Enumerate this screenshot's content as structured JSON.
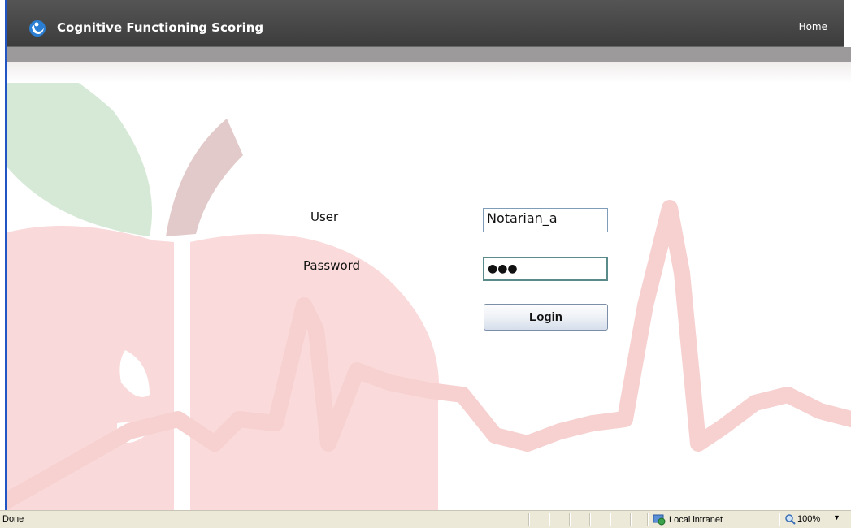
{
  "header": {
    "app_title": "Cognitive Functioning Scoring",
    "home_label": "Home"
  },
  "login": {
    "user_label": "User",
    "password_label": "Password",
    "user_value": "Notarian_a",
    "password_mask": "●●●",
    "login_button": "Login"
  },
  "status_bar": {
    "status": "Done",
    "zone": "Local intranet",
    "zoom": "100%"
  },
  "colors": {
    "header_bg": "#3c3c3c",
    "subbar_bg": "#9c9a9a",
    "apple_red": "#f9d6d6",
    "leaf_green": "#d6e9d6",
    "stem_brown": "#e2caca",
    "window_border": "#2255c4"
  },
  "icons": {
    "logo": "app-logo-icon",
    "zone": "globe-network-icon",
    "zoom": "magnifier-icon",
    "zoom_menu": "caret-down-icon"
  }
}
